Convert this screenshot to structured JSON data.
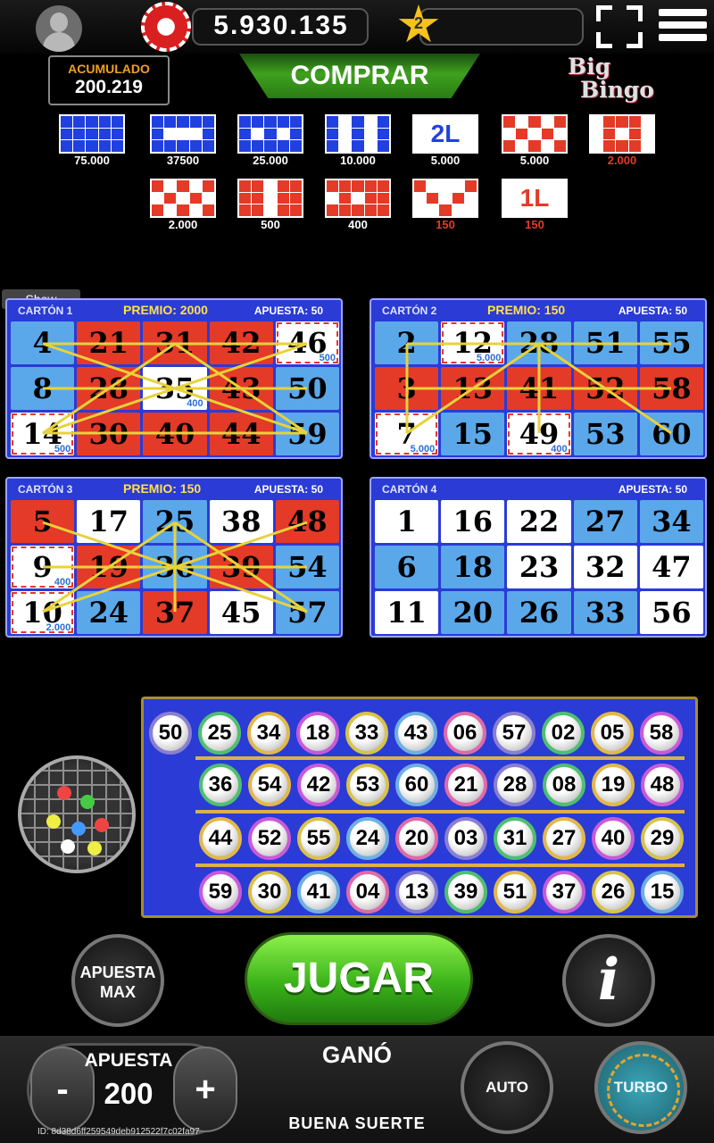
{
  "topbar": {
    "coins": "5.930.135",
    "level": "2"
  },
  "jackpot": {
    "label": "ACUMULADO",
    "value": "200.219"
  },
  "buy_label": "COMPRAR",
  "logo": {
    "line1": "Big",
    "line2": "Bingo"
  },
  "patterns": [
    {
      "prize": "75.000",
      "color": "#2040e0",
      "cells": "111111111111111",
      "overlay": ""
    },
    {
      "prize": "37500",
      "color": "#2040e0",
      "cells": "111111000111111",
      "overlay": ""
    },
    {
      "prize": "25.000",
      "color": "#2040e0",
      "cells": "111111010111111",
      "overlay": ""
    },
    {
      "prize": "10.000",
      "color": "#2040e0",
      "cells": "101011010110101",
      "overlay": ""
    },
    {
      "prize": "5.000",
      "color": "#2040e0",
      "cells": "000000000000000",
      "overlay": "2L"
    },
    {
      "prize": "5.000",
      "color": "#e43a28",
      "cells": "101010101010101",
      "overlay": ""
    },
    {
      "prize": "2.000",
      "color": "#e43a28",
      "cells": "011100101001110",
      "overlay": "",
      "red_label": true
    },
    {
      "prize": "2.000",
      "color": "#e43a28",
      "cells": "101010101010101",
      "overlay": ""
    },
    {
      "prize": "500",
      "color": "#e43a28",
      "cells": "110111101111011",
      "overlay": ""
    },
    {
      "prize": "400",
      "color": "#e43a28",
      "cells": "111110101111111",
      "overlay": ""
    },
    {
      "prize": "150",
      "color": "#e43a28",
      "cells": "100010101000100",
      "overlay": "",
      "red_label": true
    },
    {
      "prize": "150",
      "color": "#e43a28",
      "cells": "000000000000000",
      "overlay": "1L",
      "red_label": true
    }
  ],
  "show_label": "Show",
  "cards": [
    {
      "title": "CARTÓN 1",
      "premio": "PREMIO: 2000",
      "apuesta": "APUESTA: 50",
      "numbers": [
        "4",
        "21",
        "31",
        "42",
        "46",
        "8",
        "28",
        "35",
        "43",
        "50",
        "14",
        "30",
        "40",
        "44",
        "59"
      ],
      "colors": [
        "b",
        "r",
        "r",
        "r",
        "w",
        "b",
        "r",
        "w",
        "r",
        "b",
        "w",
        "r",
        "r",
        "r",
        "b"
      ],
      "dash": [
        false,
        false,
        false,
        false,
        true,
        false,
        false,
        false,
        false,
        false,
        true,
        false,
        false,
        false,
        false
      ],
      "mini": [
        "",
        "",
        "",
        "",
        "500",
        "",
        "",
        "400",
        "",
        "",
        "500",
        "",
        "",
        "",
        ""
      ]
    },
    {
      "title": "CARTÓN 2",
      "premio": "PREMIO: 150",
      "apuesta": "APUESTA: 50",
      "numbers": [
        "2",
        "12",
        "28",
        "51",
        "55",
        "3",
        "13",
        "41",
        "52",
        "58",
        "7",
        "15",
        "49",
        "53",
        "60"
      ],
      "colors": [
        "b",
        "w",
        "b",
        "b",
        "b",
        "r",
        "r",
        "r",
        "r",
        "r",
        "w",
        "b",
        "w",
        "b",
        "b"
      ],
      "dash": [
        false,
        true,
        false,
        false,
        false,
        false,
        false,
        false,
        false,
        false,
        true,
        false,
        true,
        false,
        false
      ],
      "mini": [
        "",
        "5.000",
        "",
        "",
        "",
        "",
        "",
        "",
        "",
        "",
        "5.000",
        "",
        "400",
        "",
        ""
      ]
    },
    {
      "title": "CARTÓN 3",
      "premio": "PREMIO: 150",
      "apuesta": "APUESTA: 50",
      "numbers": [
        "5",
        "17",
        "25",
        "38",
        "48",
        "9",
        "19",
        "36",
        "39",
        "54",
        "10",
        "24",
        "37",
        "45",
        "57"
      ],
      "colors": [
        "r",
        "w",
        "b",
        "w",
        "r",
        "w",
        "r",
        "b",
        "r",
        "b",
        "w",
        "b",
        "r",
        "w",
        "b"
      ],
      "dash": [
        false,
        false,
        false,
        false,
        false,
        true,
        false,
        false,
        false,
        false,
        true,
        false,
        false,
        false,
        false
      ],
      "mini": [
        "",
        "",
        "",
        "",
        "",
        "400",
        "",
        "",
        "",
        "",
        "2.000",
        "",
        "",
        "",
        ""
      ]
    },
    {
      "title": "CARTÓN 4",
      "premio": "",
      "apuesta": "APUESTA: 50",
      "numbers": [
        "1",
        "16",
        "22",
        "27",
        "34",
        "6",
        "18",
        "23",
        "32",
        "47",
        "11",
        "20",
        "26",
        "33",
        "56"
      ],
      "colors": [
        "w",
        "w",
        "w",
        "b",
        "b",
        "b",
        "b",
        "w",
        "w",
        "w",
        "w",
        "b",
        "b",
        "b",
        "w"
      ],
      "dash": [
        false,
        false,
        false,
        false,
        false,
        false,
        false,
        false,
        false,
        false,
        false,
        false,
        false,
        false,
        false
      ],
      "mini": [
        "",
        "",
        "",
        "",
        "",
        "",
        "",
        "",
        "",
        "",
        "",
        "",
        "",
        "",
        ""
      ]
    }
  ],
  "drawn_balls": {
    "row1": [
      "50",
      "25",
      "34",
      "18",
      "33",
      "43",
      "06",
      "57",
      "02",
      "05",
      "58"
    ],
    "row2": [
      "36",
      "54",
      "42",
      "53",
      "60",
      "21",
      "28",
      "08",
      "19",
      "48"
    ],
    "row3": [
      "44",
      "52",
      "55",
      "24",
      "20",
      "03",
      "31",
      "27",
      "40",
      "29"
    ],
    "row4": [
      "59",
      "30",
      "41",
      "04",
      "13",
      "39",
      "51",
      "37",
      "26",
      "15"
    ]
  },
  "buttons": {
    "apuesta_max": [
      "APUESTA",
      "MAX"
    ],
    "jugar": "JUGAR",
    "info": "i",
    "auto": "AUTO",
    "turbo": "TURBO",
    "minus": "-",
    "plus": "+"
  },
  "bet": {
    "label": "APUESTA",
    "value": "200"
  },
  "status": {
    "won_label": "GANÓ",
    "message": "BUENA SUERTE"
  },
  "session_id": "ID: 8d38d6ff259549deb912522f7c02fa97"
}
